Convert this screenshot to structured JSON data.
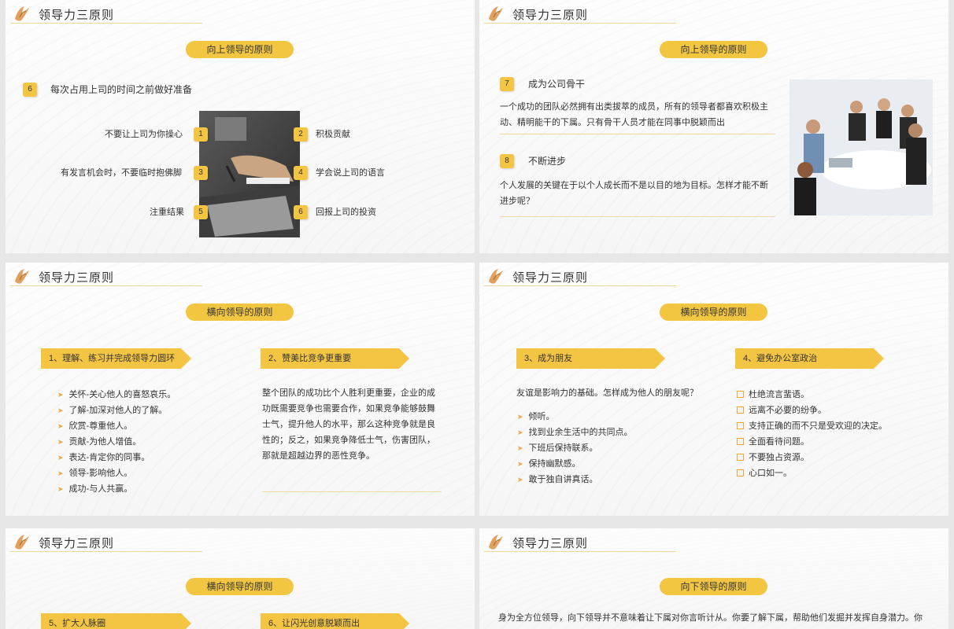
{
  "header_title": "领导力三原则",
  "s1": {
    "pill": "向上领导的原则",
    "num": "6",
    "heading": "每次占用上司的时间之前做好准备",
    "left_items": [
      {
        "num": "1",
        "label": "不要让上司为你操心"
      },
      {
        "num": "3",
        "label": "有发言机会时，不要临时抱佛脚"
      },
      {
        "num": "5",
        "label": "注重结果"
      }
    ],
    "right_items": [
      {
        "num": "2",
        "label": "积极贡献"
      },
      {
        "num": "4",
        "label": "学会说上司的语言"
      },
      {
        "num": "6",
        "label": "回报上司的投资"
      }
    ]
  },
  "s2": {
    "pill": "向上领导的原则",
    "item7_num": "7",
    "item7_title": "成为公司骨干",
    "item7_text": "一个成功的团队必然拥有出类拔萃的成员，所有的领导者都喜欢积极主动、精明能干的下属。只有骨干人员才能在同事中脱颖而出",
    "item8_num": "8",
    "item8_title": "不断进步",
    "item8_text": "个人发展的关键在于以个人成长而不是以目的地为目标。怎样才能不断进步呢？"
  },
  "s3": {
    "pill": "横向领导的原则",
    "arrow1": "1、理解、练习并完成领导力圆环",
    "arrow2": "2、赞美比竞争更重要",
    "list": [
      "关怀-关心他人的喜怒哀乐。",
      "了解-加深对他人的了解。",
      "欣赏-尊重他人。",
      "贡献-为他人增值。",
      "表达-肯定你的同事。",
      "领导-影响他人。",
      "成功-与人共赢。"
    ],
    "para": "整个团队的成功比个人胜利更重要，企业的成功既需要竞争也需要合作，如果竞争能够鼓舞士气，提升他人的水平，那么这种竞争就是良性的；反之，如果竞争降低士气，伤害团队，那就是超越边界的恶性竞争。"
  },
  "s4": {
    "pill": "横向领导的原则",
    "arrow3": "3、成为朋友",
    "arrow4": "4、避免办公室政治",
    "intro": "友谊是影响力的基础。怎样成为他人的朋友呢？",
    "list_left": [
      "倾听。",
      "找到业余生活中的共同点。",
      "下班后保持联系。",
      "保持幽默感。",
      "敢于独自讲真话。"
    ],
    "list_right": [
      "杜绝流言蜚语。",
      "远离不必要的纷争。",
      "支持正确的而不只是受欢迎的决定。",
      "全面看待问题。",
      "不要独占资源。",
      "心口如一。"
    ]
  },
  "s5": {
    "pill": "横向领导的原则",
    "arrow5": "5、扩大人脉圈",
    "arrow6": "6、让闪光创意脱颖而出"
  },
  "s6": {
    "pill": "向下领导的原则",
    "para": "身为全方位领导，向下领导并不意味着让下属对你言听计从。你要了解下属，帮助他们发掘并发挥自身潜力。你"
  }
}
